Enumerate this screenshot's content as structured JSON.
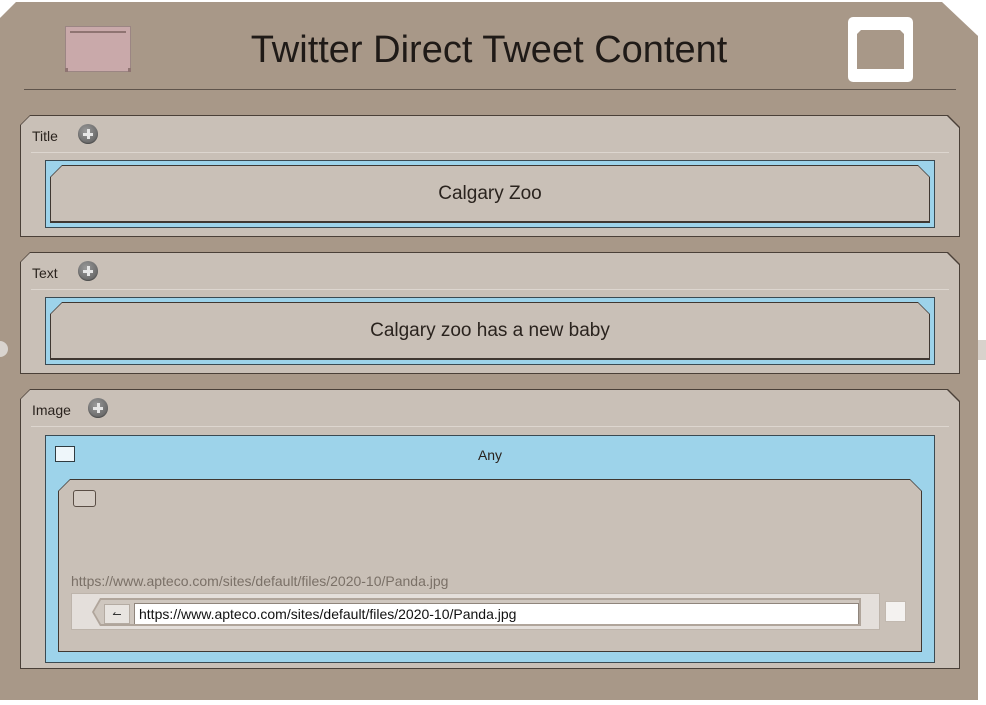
{
  "dialog": {
    "title": "Twitter Direct Tweet Content"
  },
  "panels": {
    "title": {
      "label": "Title",
      "value": "Calgary Zoo"
    },
    "text": {
      "label": "Text",
      "value": "Calgary zoo has a new baby"
    },
    "image": {
      "label": "Image",
      "selector_label": "Any",
      "url_display": "https://www.apteco.com/sites/default/files/2020-10/Panda.jpg",
      "url_input_value": "https://www.apteco.com/sites/default/files/2020-10/Panda.jpg",
      "back_glyph": "↼"
    }
  },
  "colors": {
    "background": "#a89888",
    "panel": "#c9c0b7",
    "accent_blue": "#9dd3ea",
    "close_button": "#ffffff"
  },
  "icons": {
    "header_left": "document-tab-icon",
    "close": "close-window-icon",
    "add": "plus-circle-icon",
    "image_placeholder": "image-placeholder-icon"
  }
}
